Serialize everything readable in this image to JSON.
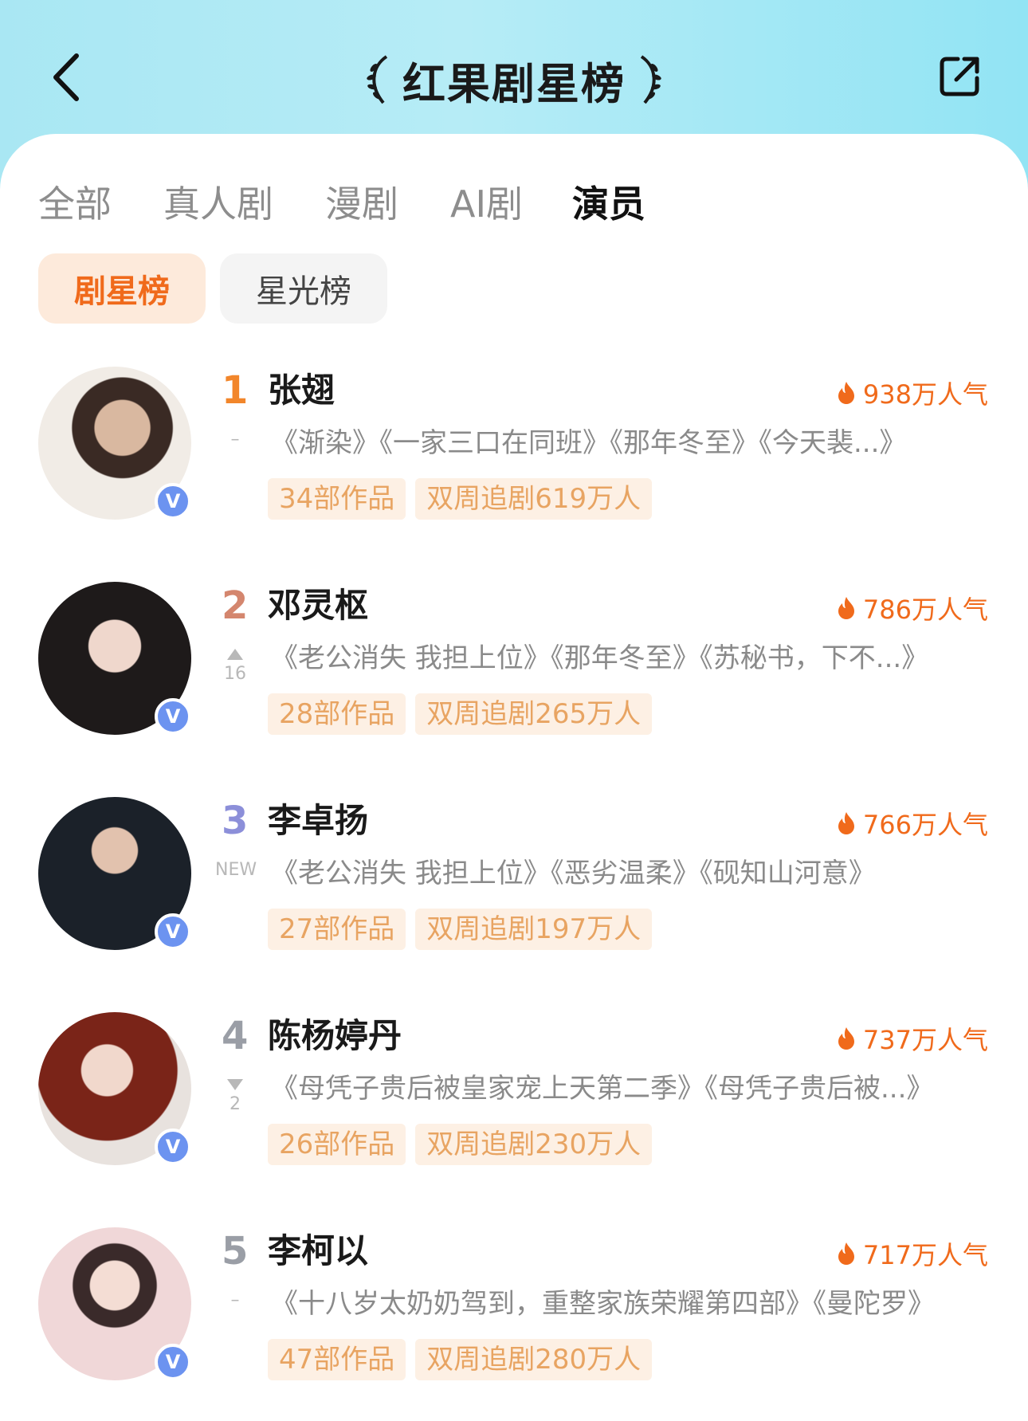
{
  "header": {
    "title": "红果剧星榜",
    "background": "#a9e7f3"
  },
  "tabs": [
    {
      "label": "全部",
      "active": false
    },
    {
      "label": "真人剧",
      "active": false
    },
    {
      "label": "漫剧",
      "active": false
    },
    {
      "label": "AI剧",
      "active": false
    },
    {
      "label": "演员",
      "active": true
    }
  ],
  "subtabs": [
    {
      "label": "剧星榜",
      "active": true
    },
    {
      "label": "星光榜",
      "active": false
    }
  ],
  "colors": {
    "accent": "#f06a1b",
    "tag_text": "#e8a462",
    "tag_bg": "#fdf0e4",
    "rank1": "#f2862b",
    "rank2": "#d4866e",
    "rank3": "#8c8fd9",
    "rank_other": "#9a9ea6",
    "verified": "#6c93f0"
  },
  "actors": [
    {
      "rank": "1",
      "change": "–",
      "name": "张翅",
      "popularity": "938万人气",
      "works": "《渐染》《一家三口在同班》《那年冬至》《今天裴...》",
      "tag_works": "34部作品",
      "tag_followers": "双周追剧619万人"
    },
    {
      "rank": "2",
      "change": "16",
      "change_dir": "up",
      "name": "邓灵枢",
      "popularity": "786万人气",
      "works": "《老公消失 我担上位》《那年冬至》《苏秘书，下不...》",
      "tag_works": "28部作品",
      "tag_followers": "双周追剧265万人"
    },
    {
      "rank": "3",
      "change": "NEW",
      "name": "李卓扬",
      "popularity": "766万人气",
      "works": "《老公消失 我担上位》《恶劣温柔》《砚知山河意》",
      "tag_works": "27部作品",
      "tag_followers": "双周追剧197万人"
    },
    {
      "rank": "4",
      "change": "2",
      "change_dir": "down",
      "name": "陈杨婷丹",
      "popularity": "737万人气",
      "works": "《母凭子贵后被皇家宠上天第二季》《母凭子贵后被...》",
      "tag_works": "26部作品",
      "tag_followers": "双周追剧230万人"
    },
    {
      "rank": "5",
      "change": "–",
      "name": "李柯以",
      "popularity": "717万人气",
      "works": "《十八岁太奶奶驾到，重整家族荣耀第四部》《曼陀罗》",
      "tag_works": "47部作品",
      "tag_followers": "双周追剧280万人"
    }
  ],
  "verified_badge": "V"
}
